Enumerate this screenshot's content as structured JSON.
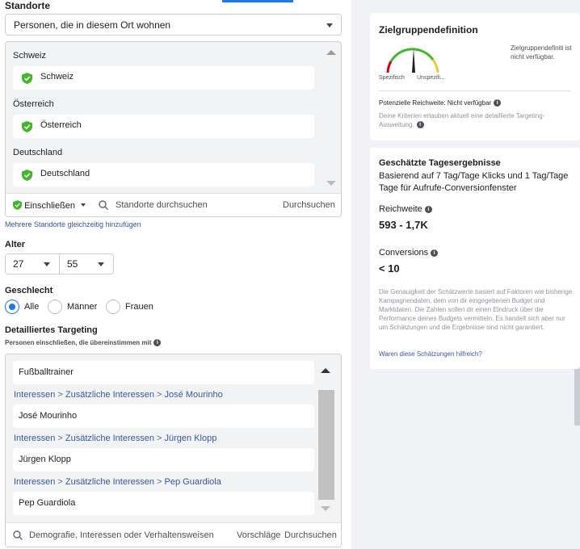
{
  "locations": {
    "heading": "Standorte",
    "mode": "Personen, die in diesem Ort wohnen",
    "groups": [
      {
        "country": "Schweiz",
        "item": "Schweiz"
      },
      {
        "country": "Österreich",
        "item": "Österreich"
      },
      {
        "country": "Deutschland",
        "item": "Deutschland"
      }
    ],
    "include_label": "Einschließen",
    "search_placeholder": "Standorte durchsuchen",
    "search_button": "Durchsuchen",
    "bulk_link": "Mehrere Standorte gleichzeitig hinzufügen"
  },
  "age": {
    "heading": "Alter",
    "min": "27",
    "max": "55"
  },
  "gender": {
    "heading": "Geschlecht",
    "options": [
      "Alle",
      "Männer",
      "Frauen"
    ],
    "selected": "Alle"
  },
  "detailed": {
    "heading": "Detailliertes Targeting",
    "subheading": "Personen einschließen, die übereinstimmen mit",
    "items": [
      {
        "label": "Fußballtrainer"
      },
      {
        "path": [
          "Interessen",
          "Zusätzliche Interessen",
          "José Mourinho"
        ],
        "label": "José Mourinho"
      },
      {
        "path": [
          "Interessen",
          "Zusätzliche Interessen",
          "Jürgen Klopp"
        ],
        "label": "Jürgen Klopp"
      },
      {
        "path": [
          "Interessen",
          "Zusätzliche Interessen",
          "Pep Guardiola"
        ],
        "label": "Pep Guardiola"
      }
    ],
    "search_placeholder": "Demografie, Interessen oder Verhaltensweisen",
    "suggest_button": "Vorschläge",
    "search_button": "Durchsuchen"
  },
  "audience": {
    "title": "Zielgruppendefinition",
    "gauge_left": "Spezifisch",
    "gauge_right": "Unspezifi...",
    "unavailable": "Zielgruppendefiniti ist nicht verfügbar.",
    "potential_reach": "Potenzielle Reichweite: Nicht verfügbar",
    "criteria_note": "Deine Kriterien erlauben aktuell eine detaillierte Targeting-Ausweitung."
  },
  "estimates": {
    "title": "Geschätzte Tagesergebnisse",
    "basis": "Basierend auf 7 Tag/Tage Klicks und 1 Tag/Tage Tage für Aufrufe-Conversionfenster",
    "reach_label": "Reichweite",
    "reach_value": "593 - 1,7K",
    "conv_label": "Conversions",
    "conv_value": "< 10",
    "disclaimer": "Die Genauigkeit der Schätzwerte basiert auf Faktoren wie bisherige Kampagnendaten, dem von dir eingegebenen Budget und Marktdaten. Die Zahlen sollen dir einen Eindruck über die Performance deines Budgets vermitteln. Es handelt sich aber nur um Schätzungen und die Ergebnisse sind nicht garantiert.",
    "feedback_link": "Waren diese Schätzungen hilfreich?"
  },
  "icons": {
    "shield": "shield-check-icon",
    "search": "search-icon",
    "info": "info-icon"
  },
  "colors": {
    "accent": "#1877f2",
    "link": "#385898",
    "green": "#42b72a",
    "panel": "#f0f2f5"
  }
}
